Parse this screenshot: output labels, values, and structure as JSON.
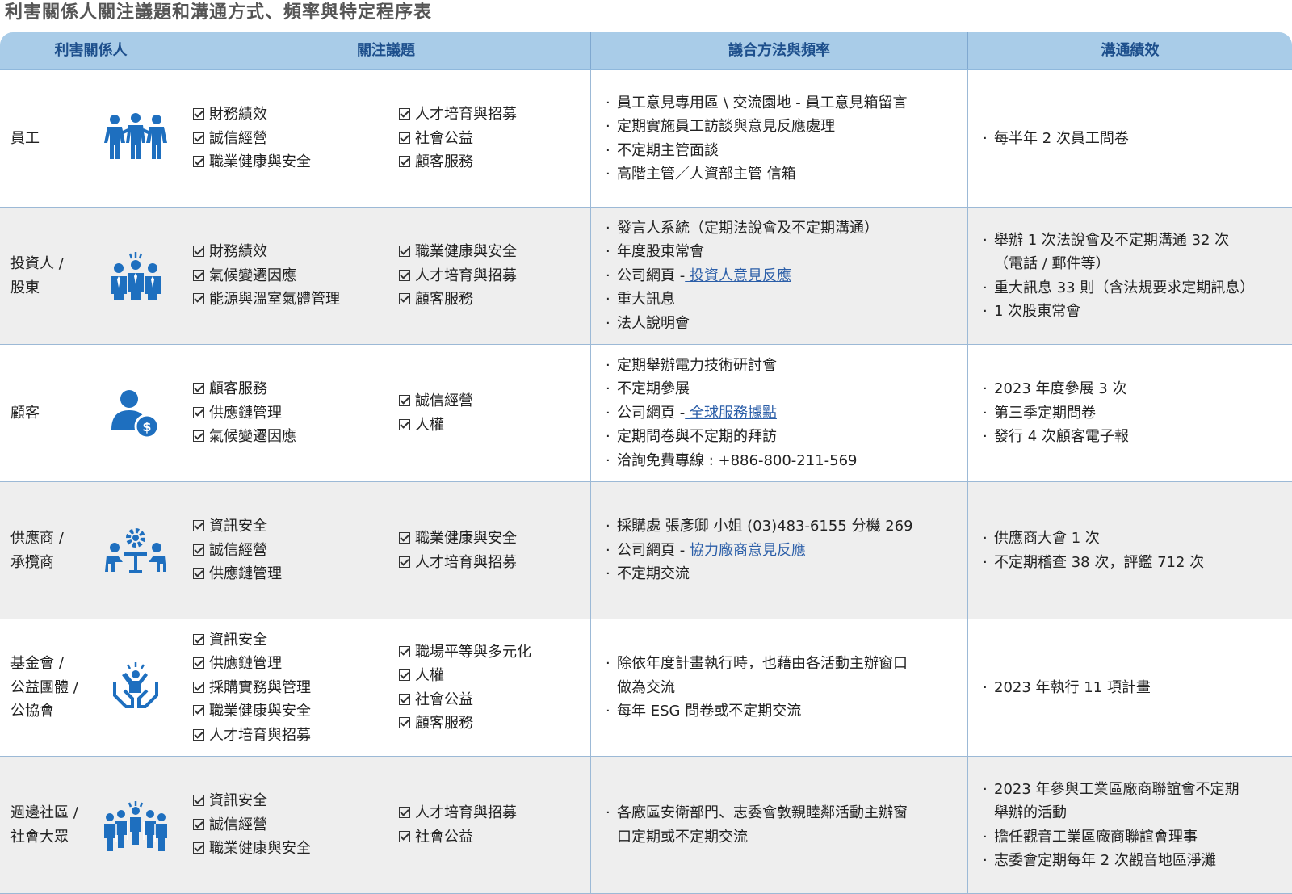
{
  "title": "利害關係人關注議題和溝通方式、頻率與特定程序表",
  "headers": [
    "利害關係人",
    "關注議題",
    "議合方法與頻率",
    "溝通績效"
  ],
  "colors": {
    "header_bg": "#a9cce8",
    "header_text": "#1d4f8c",
    "icon_blue": "#1e6fbf",
    "shade": "#eeeeee",
    "link": "#2b5ea8"
  },
  "rows": [
    {
      "name": [
        "員工"
      ],
      "icon": "employees-icon",
      "topics_a": [
        "財務績效",
        "誠信經營",
        "職業健康與安全"
      ],
      "topics_b": [
        "人才培育與招募",
        "社會公益",
        "顧客服務"
      ],
      "methods": [
        {
          "text": "員工意見專用區 \\ 交流園地 - 員工意見箱留言"
        },
        {
          "text": "定期實施員工訪談與意見反應處理"
        },
        {
          "text": "不定期主管面談"
        },
        {
          "text": "高階主管／人資部主管 信箱"
        }
      ],
      "perf": [
        "每半年 2 次員工問卷"
      ]
    },
    {
      "name": [
        "投資人 /",
        "股東"
      ],
      "icon": "investors-icon",
      "topics_a": [
        "財務績效",
        "氣候變遷因應",
        "能源與溫室氣體管理"
      ],
      "topics_b": [
        "職業健康與安全",
        "人才培育與招募",
        "顧客服務"
      ],
      "methods": [
        {
          "text": "發言人系統（定期法說會及不定期溝通）"
        },
        {
          "text": "年度股東常會"
        },
        {
          "text": "公司網頁 -",
          "link": "投資人意見反應"
        },
        {
          "text": "重大訊息"
        },
        {
          "text": "法人說明會"
        }
      ],
      "perf": [
        "舉辦 1 次法說會及不定期溝通 32 次",
        "（電話 / 郵件等）",
        "重大訊息 33 則（含法規要求定期訊息）",
        "1 次股東常會"
      ]
    },
    {
      "name": [
        "顧客"
      ],
      "icon": "customer-icon",
      "topics_a": [
        "顧客服務",
        "供應鏈管理",
        "氣候變遷因應"
      ],
      "topics_b": [
        "誠信經營",
        "人權"
      ],
      "methods": [
        {
          "text": "定期舉辦電力技術研討會"
        },
        {
          "text": "不定期參展"
        },
        {
          "text": "公司網頁 -",
          "link": "全球服務據點"
        },
        {
          "text": "定期問卷與不定期的拜訪"
        },
        {
          "text": "洽詢免費專線 : +886-800-211-569"
        }
      ],
      "perf": [
        "2023 年度參展 3 次",
        "第三季定期問卷",
        "發行 4 次顧客電子報"
      ]
    },
    {
      "name": [
        "供應商 /",
        "承攬商"
      ],
      "icon": "suppliers-icon",
      "topics_a": [
        "資訊安全",
        "誠信經營",
        "供應鏈管理"
      ],
      "topics_b": [
        "職業健康與安全",
        "人才培育與招募"
      ],
      "methods": [
        {
          "text": "採購處 張彥卿 小姐 (03)483-6155 分機 269"
        },
        {
          "text": "公司網頁 -",
          "link": "協力廠商意見反應"
        },
        {
          "text": "不定期交流"
        }
      ],
      "perf": [
        "供應商大會 1 次",
        "不定期稽查 38 次，評鑑 712 次"
      ]
    },
    {
      "name": [
        "基金會 /",
        "公益團體 /",
        "公協會"
      ],
      "icon": "foundation-icon",
      "topics_a": [
        "資訊安全",
        "供應鏈管理",
        "採購實務與管理",
        "職業健康與安全",
        "人才培育與招募"
      ],
      "topics_b": [
        "職場平等與多元化",
        "人權",
        "社會公益",
        "顧客服務"
      ],
      "methods": [
        {
          "text": "除依年度計畫執行時，也藉由各活動主辦窗口",
          "cont": "做為交流"
        },
        {
          "text": "每年 ESG 問卷或不定期交流"
        }
      ],
      "perf": [
        "2023 年執行 11 項計畫"
      ]
    },
    {
      "name": [
        "週邊社區 /",
        "社會大眾"
      ],
      "icon": "community-icon",
      "topics_a": [
        "資訊安全",
        "誠信經營",
        "職業健康與安全"
      ],
      "topics_b": [
        "人才培育與招募",
        "社會公益"
      ],
      "methods": [
        {
          "text": "各廠區安衛部門、志委會敦親睦鄰活動主辦窗",
          "cont": "口定期或不定期交流"
        }
      ],
      "perf": [
        "2023 年參與工業區廠商聯誼會不定期",
        "舉辦的活動",
        "擔任觀音工業區廠商聯誼會理事",
        "志委會定期每年 2 次觀音地區淨灘"
      ]
    }
  ]
}
